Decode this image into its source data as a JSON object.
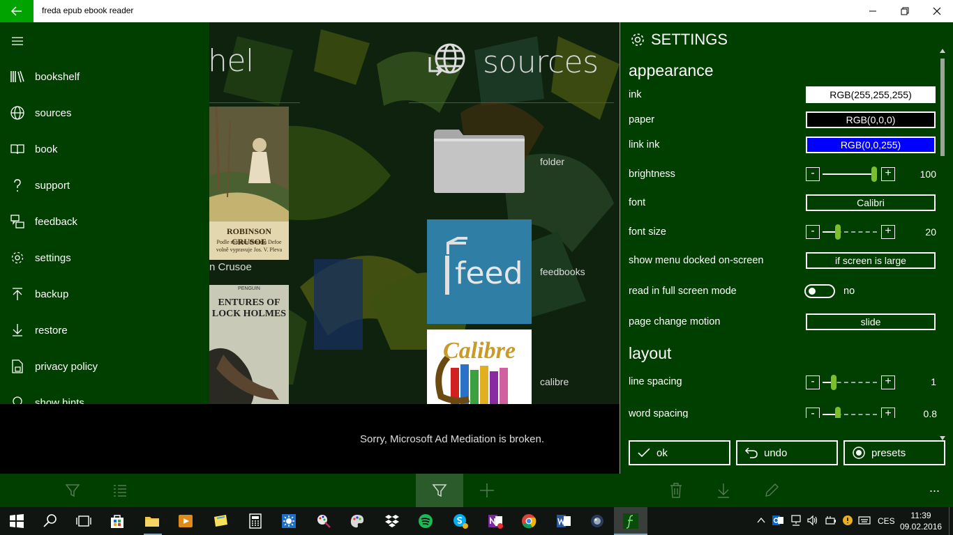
{
  "window": {
    "title": "freda epub ebook reader"
  },
  "menu": {
    "items": [
      {
        "label": "bookshelf",
        "icon": "bookshelf-icon"
      },
      {
        "label": "sources",
        "icon": "globe-icon"
      },
      {
        "label": "book",
        "icon": "open-book-icon"
      },
      {
        "label": "support",
        "icon": "question-icon"
      },
      {
        "label": "feedback",
        "icon": "feedback-icon"
      },
      {
        "label": "settings",
        "icon": "gear-icon"
      },
      {
        "label": "backup",
        "icon": "upload-icon"
      },
      {
        "label": "restore",
        "icon": "download-icon"
      },
      {
        "label": "privacy policy",
        "icon": "document-lock-icon"
      },
      {
        "label": "show hints",
        "icon": "hint-icon"
      }
    ]
  },
  "bookshelf": {
    "title_fragment": "helf",
    "books": [
      {
        "cover_title": "ROBINSON CRUSOE",
        "cover_sub1": "Podle románu Daniela Defoe",
        "cover_sub2": "volně vypravuje Jos. V. Pleva",
        "label": "n Crusoe"
      },
      {
        "cover_title_1": "ENTURES OF",
        "cover_title_2": "LOCK HOLMES",
        "publisher": "PENGUIN"
      }
    ]
  },
  "sources": {
    "title": "sources",
    "items": [
      {
        "label": "folder"
      },
      {
        "label": "feedbooks",
        "tile_text": "feed"
      },
      {
        "label": "calibre",
        "tile_text": "Calibre"
      }
    ]
  },
  "ad": {
    "message": "Sorry, Microsoft Ad Mediation is broken."
  },
  "settings": {
    "title": "SETTINGS",
    "appearance_heading": "appearance",
    "layout_heading": "layout",
    "ink": {
      "label": "ink",
      "value": "RGB(255,255,255)",
      "color": "#ffffff"
    },
    "paper": {
      "label": "paper",
      "value": "RGB(0,0,0)",
      "color": "#000000"
    },
    "link_ink": {
      "label": "link ink",
      "value": "RGB(0,0,255)",
      "color": "#0000ff"
    },
    "brightness": {
      "label": "brightness",
      "value": "100",
      "level": 1.0
    },
    "font": {
      "label": "font",
      "value": "Calibri"
    },
    "font_size": {
      "label": "font size",
      "value": "20",
      "level": 0.25
    },
    "show_menu": {
      "label": "show menu docked on-screen",
      "value": "if screen is large"
    },
    "full_screen": {
      "label": "read in full screen mode",
      "value": "no",
      "on": false
    },
    "page_change": {
      "label": "page change motion",
      "value": "slide"
    },
    "line_spacing": {
      "label": "line spacing",
      "value": "1",
      "level": 0.2
    },
    "word_spacing": {
      "label": "word spacing",
      "value": "0.8",
      "level": 0.25
    },
    "buttons": {
      "ok": "ok",
      "undo": "undo",
      "presets": "presets"
    },
    "minus": "-",
    "plus": "+"
  },
  "appbar": {
    "more": "..."
  },
  "taskbar": {
    "time": "11:39",
    "date": "09.02.2016",
    "language": "CES"
  },
  "colors": {
    "accent": "#00a300",
    "panel": "#003f00",
    "slider_thumb": "#7cbf2b"
  }
}
